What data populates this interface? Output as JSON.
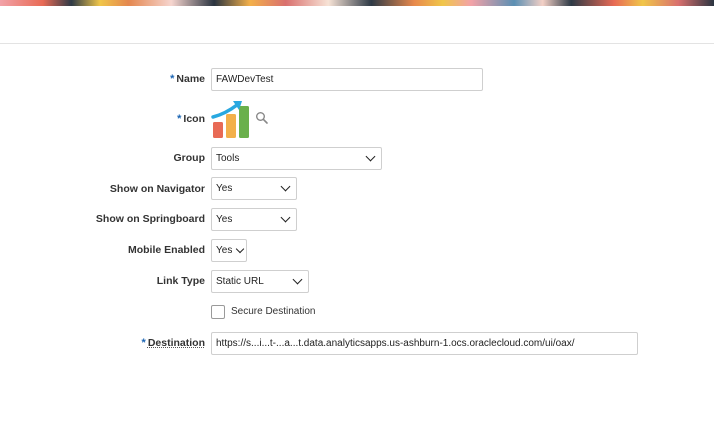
{
  "form": {
    "name": {
      "label": "Name",
      "required_mark": "*",
      "value": "FAWDevTest"
    },
    "icon": {
      "label": "Icon",
      "required_mark": "*",
      "image": "bar-chart-trend-icon"
    },
    "group": {
      "label": "Group",
      "value": "Tools"
    },
    "show_on_navigator": {
      "label": "Show on Navigator",
      "value": "Yes"
    },
    "show_on_springboard": {
      "label": "Show on Springboard",
      "value": "Yes"
    },
    "mobile_enabled": {
      "label": "Mobile Enabled",
      "value": "Yes"
    },
    "link_type": {
      "label": "Link Type",
      "value": "Static URL"
    },
    "secure_destination": {
      "label": "Secure Destination",
      "checked": false
    },
    "destination": {
      "label": "Destination",
      "required_mark": "*",
      "value": "https://s...i...t-...a...t.data.analyticsapps.us-ashburn-1.ocs.oraclecloud.com/ui/oax/"
    }
  },
  "colors": {
    "required": "#1a64b3",
    "icon_arrow": "#29a8e0",
    "icon_bar_red": "#e86a55",
    "icon_bar_orange": "#f3b04a",
    "icon_bar_green": "#6ab04c"
  }
}
